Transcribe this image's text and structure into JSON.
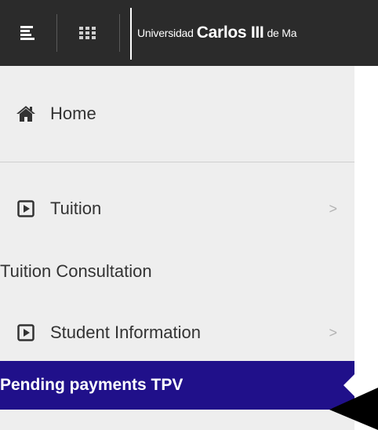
{
  "header": {
    "menu_icon": "hamburger-menu-icon",
    "apps_icon": "apps-grid-icon",
    "logo": {
      "prefix": "Universidad",
      "name": "Carlos III",
      "suffix": "de Ma"
    }
  },
  "sidebar": {
    "home_label": "Home",
    "items": [
      {
        "label": "Tuition",
        "icon": "play-square-icon",
        "has_submenu": true
      },
      {
        "label": "Tuition Consultation",
        "icon": "",
        "has_submenu": false
      },
      {
        "label": "Student Information",
        "icon": "play-square-icon",
        "has_submenu": true
      },
      {
        "label": "Pending payments TPV",
        "icon": "",
        "has_submenu": false,
        "active": true
      }
    ],
    "chevron": ">"
  },
  "colors": {
    "header_bg": "#2b2b2b",
    "sidebar_bg": "#eeeeee",
    "active_bg": "#20108a",
    "text": "#333333",
    "chevron": "#b3b3b3"
  }
}
